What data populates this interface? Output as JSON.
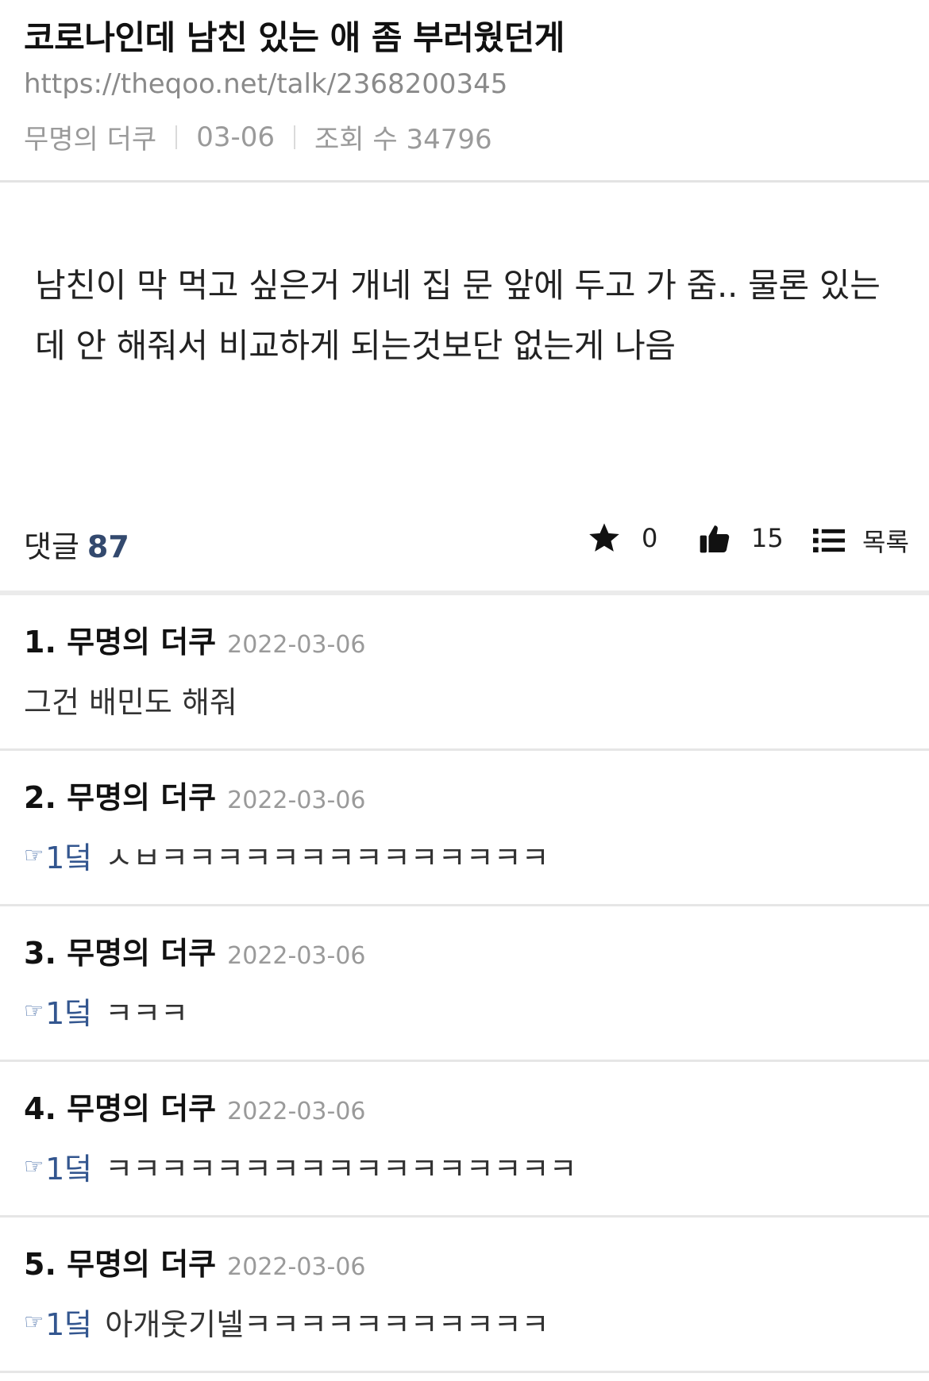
{
  "post": {
    "title": "코로나인데 남친 있는 애 좀 부러웠던게",
    "url": "https://theqoo.net/talk/2368200345",
    "author": "무명의 더쿠",
    "date": "03-06",
    "views": "조회 수 34796",
    "body": "남친이 막 먹고 싶은거 개네 집 문 앞에 두고 가 줌.. 물론 있는데 안 해줘서 비교하게 되는것보단 없는게 나음"
  },
  "actions": {
    "comment_label": "댓글",
    "comment_count": "87",
    "favorite_icon": "star-icon",
    "favorite_count": "0",
    "like_icon": "thumbs-up-icon",
    "like_count": "15",
    "list_icon": "list-icon",
    "list_label": "목록"
  },
  "comments": [
    {
      "author": "1. 무명의 더쿠",
      "date": "2022-03-06",
      "reply_to": "",
      "text": "그건 배민도 해줘"
    },
    {
      "author": "2. 무명의 더쿠",
      "date": "2022-03-06",
      "reply_to": "1덬",
      "text": "ㅅㅂㅋㅋㅋㅋㅋㅋㅋㅋㅋㅋㅋㅋㅋㅋ"
    },
    {
      "author": "3. 무명의 더쿠",
      "date": "2022-03-06",
      "reply_to": "1덬",
      "text": "ㅋㅋㅋ"
    },
    {
      "author": "4. 무명의 더쿠",
      "date": "2022-03-06",
      "reply_to": "1덬",
      "text": "ㅋㅋㅋㅋㅋㅋㅋㅋㅋㅋㅋㅋㅋㅋㅋㅋㅋ"
    },
    {
      "author": "5. 무명의 더쿠",
      "date": "2022-03-06",
      "reply_to": "1덬",
      "text": "아개웃기넬ㅋㅋㅋㅋㅋㅋㅋㅋㅋㅋㅋ"
    }
  ],
  "colors": {
    "accent": "#33496e",
    "reply_link": "#33568f",
    "meta_gray": "#9a9a9a"
  }
}
